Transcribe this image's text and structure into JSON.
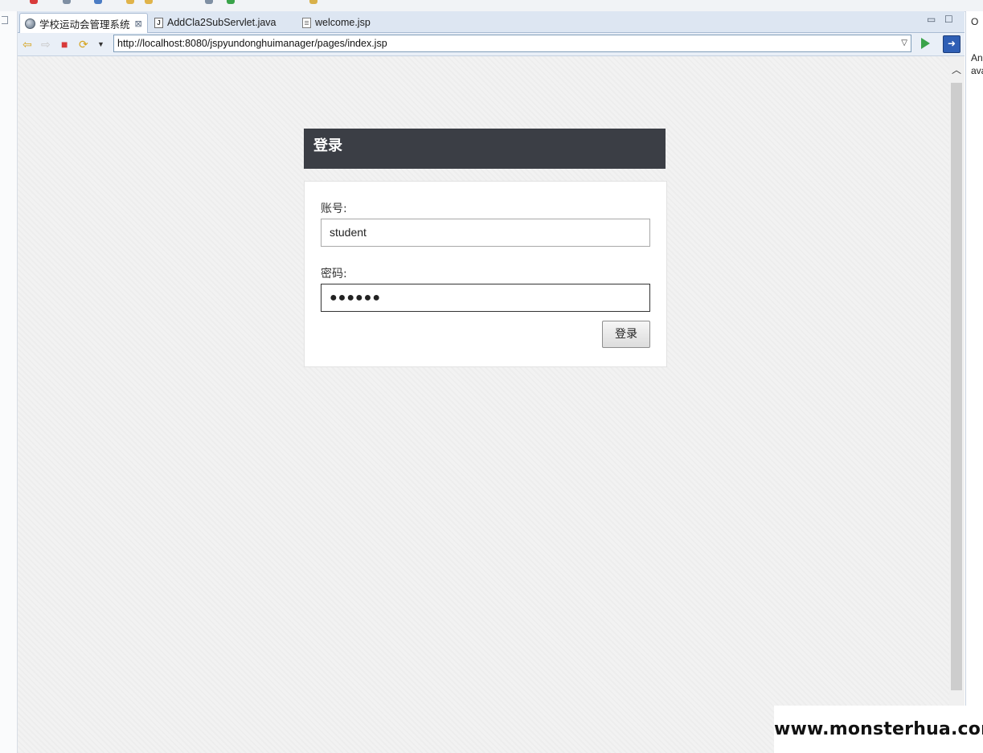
{
  "tabs": [
    {
      "label": "学校运动会管理系统",
      "active": true,
      "icon": "globe-icon",
      "close": "⊠"
    },
    {
      "label": "AddCla2SubServlet.java",
      "active": false,
      "icon": "java-file-icon"
    },
    {
      "label": "welcome.jsp",
      "active": false,
      "icon": "jsp-file-icon"
    }
  ],
  "address_bar": {
    "url": "http://localhost:8080/jspyundonghuimanager/pages/index.jsp"
  },
  "right_panel": {
    "tab_label": "O",
    "text_line1": "An",
    "text_line2": "ava"
  },
  "login": {
    "title": "登录",
    "account_label": "账号:",
    "account_value": "student",
    "password_label": "密码:",
    "password_masked": "●●●●●●",
    "submit_label": "登录"
  },
  "watermark": "www.monsterhua.com",
  "colors": {
    "header_bg": "#3b3e45",
    "page_bg": "#f2f2f2",
    "tab_bar_bg": "#dde6f2"
  }
}
